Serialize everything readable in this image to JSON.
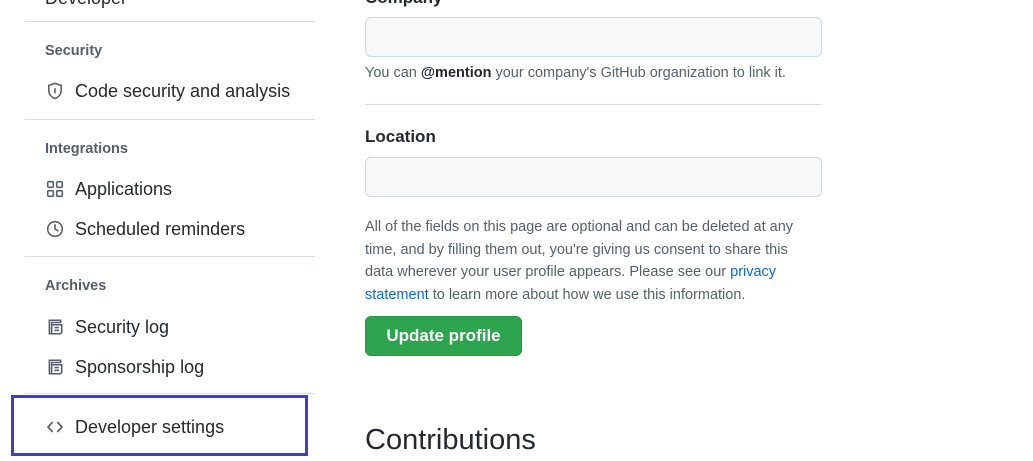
{
  "sidebar": {
    "cut_item": "Developer",
    "sections": [
      {
        "header": "Security",
        "items": [
          {
            "label": "Code security and analysis",
            "icon": "shield-lock-icon"
          }
        ]
      },
      {
        "header": "Integrations",
        "items": [
          {
            "label": "Applications",
            "icon": "apps-grid-icon"
          },
          {
            "label": "Scheduled reminders",
            "icon": "clock-icon"
          }
        ]
      },
      {
        "header": "Archives",
        "items": [
          {
            "label": "Security log",
            "icon": "log-icon"
          },
          {
            "label": "Sponsorship log",
            "icon": "log-icon"
          }
        ]
      }
    ],
    "developer_settings": {
      "label": "Developer settings",
      "icon": "code-icon"
    },
    "highlight_color": "#3f3fbf"
  },
  "main": {
    "company": {
      "label": "Company",
      "value": "",
      "note_prefix": "You can ",
      "note_mention": "@mention",
      "note_suffix": " your company's GitHub organization to link it."
    },
    "location": {
      "label": "Location",
      "value": ""
    },
    "disclaimer": {
      "text_before": "All of the fields on this page are optional and can be deleted at any time, and by filling them out, you're giving us consent to share this data wherever your user profile appears. Please see our ",
      "link_text": "privacy statement",
      "text_after": " to learn more about how we use this information."
    },
    "update_button": "Update profile",
    "contributions_title": "Contributions"
  },
  "colors": {
    "primary_button": "#2da44e",
    "link": "#0969da",
    "muted_text": "#57606a"
  }
}
